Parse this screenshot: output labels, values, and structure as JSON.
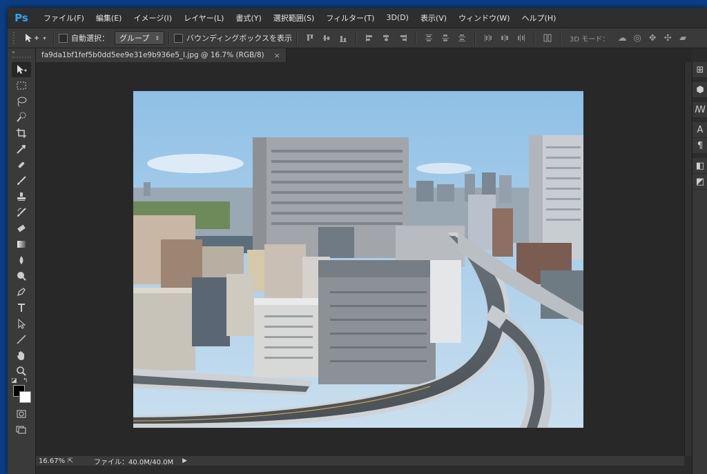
{
  "app": {
    "logo": "Ps"
  },
  "menu": [
    "ファイル(F)",
    "編集(E)",
    "イメージ(I)",
    "レイヤー(L)",
    "書式(Y)",
    "選択範囲(S)",
    "フィルター(T)",
    "3D(D)",
    "表示(V)",
    "ウィンドウ(W)",
    "ヘルプ(H)"
  ],
  "options": {
    "tool_preset_icon": "move-tool-icon",
    "auto_select_label": "自動選択：",
    "auto_select_checked": false,
    "group_select": "グループ",
    "bounding_box_label": "バウンディングボックスを表示",
    "bounding_box_checked": false,
    "mode3d_label": "3D モード："
  },
  "document": {
    "tab_title": "fa9da1bf1fef5b0dd5ee9e31e9b936e5_l.jpg @ 16.7% (RGB/8)",
    "close": "×"
  },
  "status": {
    "zoom": "16.67%",
    "doc_size": "ファイル：40.0M/40.0M"
  },
  "tools": [
    "move-tool",
    "marquee-tool",
    "lasso-tool",
    "quick-select-tool",
    "crop-tool",
    "eyedropper-tool",
    "healing-brush-tool",
    "brush-tool",
    "clone-stamp-tool",
    "history-brush-tool",
    "eraser-tool",
    "gradient-tool",
    "blur-tool",
    "dodge-tool",
    "pen-tool",
    "type-tool",
    "path-select-tool",
    "line-tool",
    "hand-tool",
    "zoom-tool"
  ],
  "colors": {
    "foreground": "#000000",
    "background": "#ffffff",
    "accent": "#2fa3ff"
  },
  "right_panel": [
    "history-icon",
    "3d-icon",
    "brush-settings-icon",
    "character-icon",
    "paragraph-icon",
    "layers-icon",
    "paths-icon"
  ]
}
